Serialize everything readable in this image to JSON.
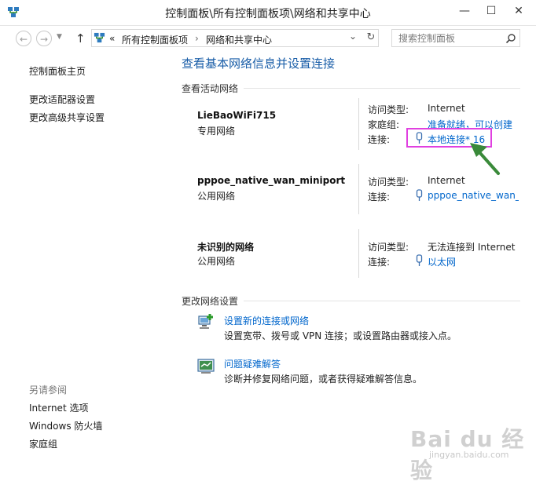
{
  "window": {
    "title": "控制面板\\所有控制面板项\\网络和共享中心",
    "minimize": "—",
    "maximize": "☐",
    "close": "✕"
  },
  "nav": {
    "back": "←",
    "forward": "→",
    "up": "↑",
    "breadcrumb_sep": "«",
    "crumb1": "所有控制面板项",
    "crumb_arrow": "›",
    "crumb2": "网络和共享中心",
    "dropdown": "⌄",
    "refresh": "↻",
    "search_placeholder": "搜索控制面板"
  },
  "sidebar": {
    "home": "控制面板主页",
    "adapter": "更改适配器设置",
    "sharing": "更改高级共享设置",
    "see_also_title": "另请参阅",
    "see_also": [
      "Internet 选项",
      "Windows 防火墙",
      "家庭组"
    ]
  },
  "main": {
    "title": "查看基本网络信息并设置连接",
    "active_header": "查看活动网络",
    "networks": [
      {
        "name": "LieBaoWiFi715",
        "type": "专用网络",
        "access_label": "访问类型:",
        "access_value": "Internet",
        "homegroup_label": "家庭组:",
        "homegroup_value": "准备就绪，可以创建",
        "conn_label": "连接:",
        "conn_value": "本地连接* 16"
      },
      {
        "name": "pppoe_native_wan_miniport",
        "type": "公用网络",
        "access_label": "访问类型:",
        "access_value": "Internet",
        "conn_label": "连接:",
        "conn_value": "pppoe_native_wan_r"
      },
      {
        "name": "未识别的网络",
        "type": "公用网络",
        "access_label": "访问类型:",
        "access_value": "无法连接到 Internet",
        "conn_label": "连接:",
        "conn_value": "以太网"
      }
    ],
    "change_header": "更改网络设置",
    "setup_link": "设置新的连接或网络",
    "setup_desc": "设置宽带、拨号或 VPN 连接；或设置路由器或接入点。",
    "trouble_link": "问题疑难解答",
    "trouble_desc": "诊断并修复网络问题，或者获得疑难解答信息。"
  },
  "colors": {
    "highlight_box": "#e040e0",
    "arrow": "#3a8a3a",
    "link": "#0066cc",
    "title": "#1a5ea8"
  },
  "watermark": {
    "logo": "Bai du 经验",
    "url": "jingyan.baidu.com"
  }
}
